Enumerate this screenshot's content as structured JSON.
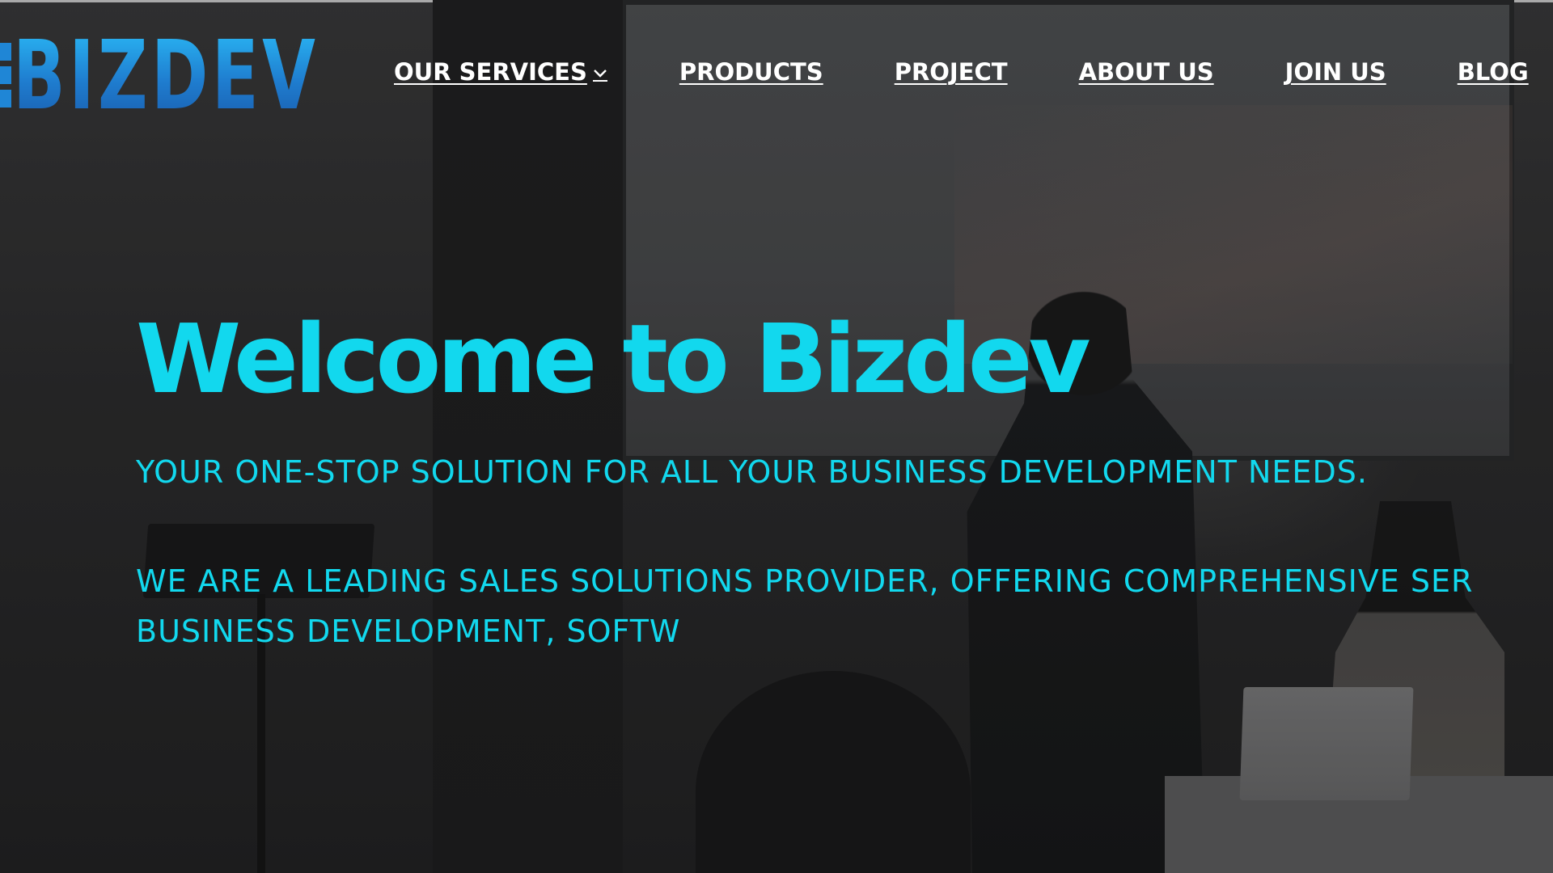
{
  "brand": {
    "logo_text": "BIZDEV",
    "logo_color": "#1f86d6"
  },
  "nav": {
    "items": [
      {
        "label": "OUR SERVICES",
        "has_dropdown": true
      },
      {
        "label": "PRODUCTS"
      },
      {
        "label": "PROJECT"
      },
      {
        "label": "ABOUT US"
      },
      {
        "label": "JOIN US"
      },
      {
        "label": "BLOG"
      }
    ],
    "dropdown_icon": "chevron-down-icon"
  },
  "hero": {
    "title": "Welcome to Bizdev",
    "tagline": "YOUR ONE-STOP SOLUTION FOR ALL YOUR BUSINESS DEVELOPMENT NEEDS.",
    "description_line1": "WE ARE A LEADING SALES SOLUTIONS PROVIDER, OFFERING COMPREHENSIVE SER",
    "description_line2": "BUSINESS DEVELOPMENT, SOFTW",
    "text_color": "#12d8ee"
  }
}
